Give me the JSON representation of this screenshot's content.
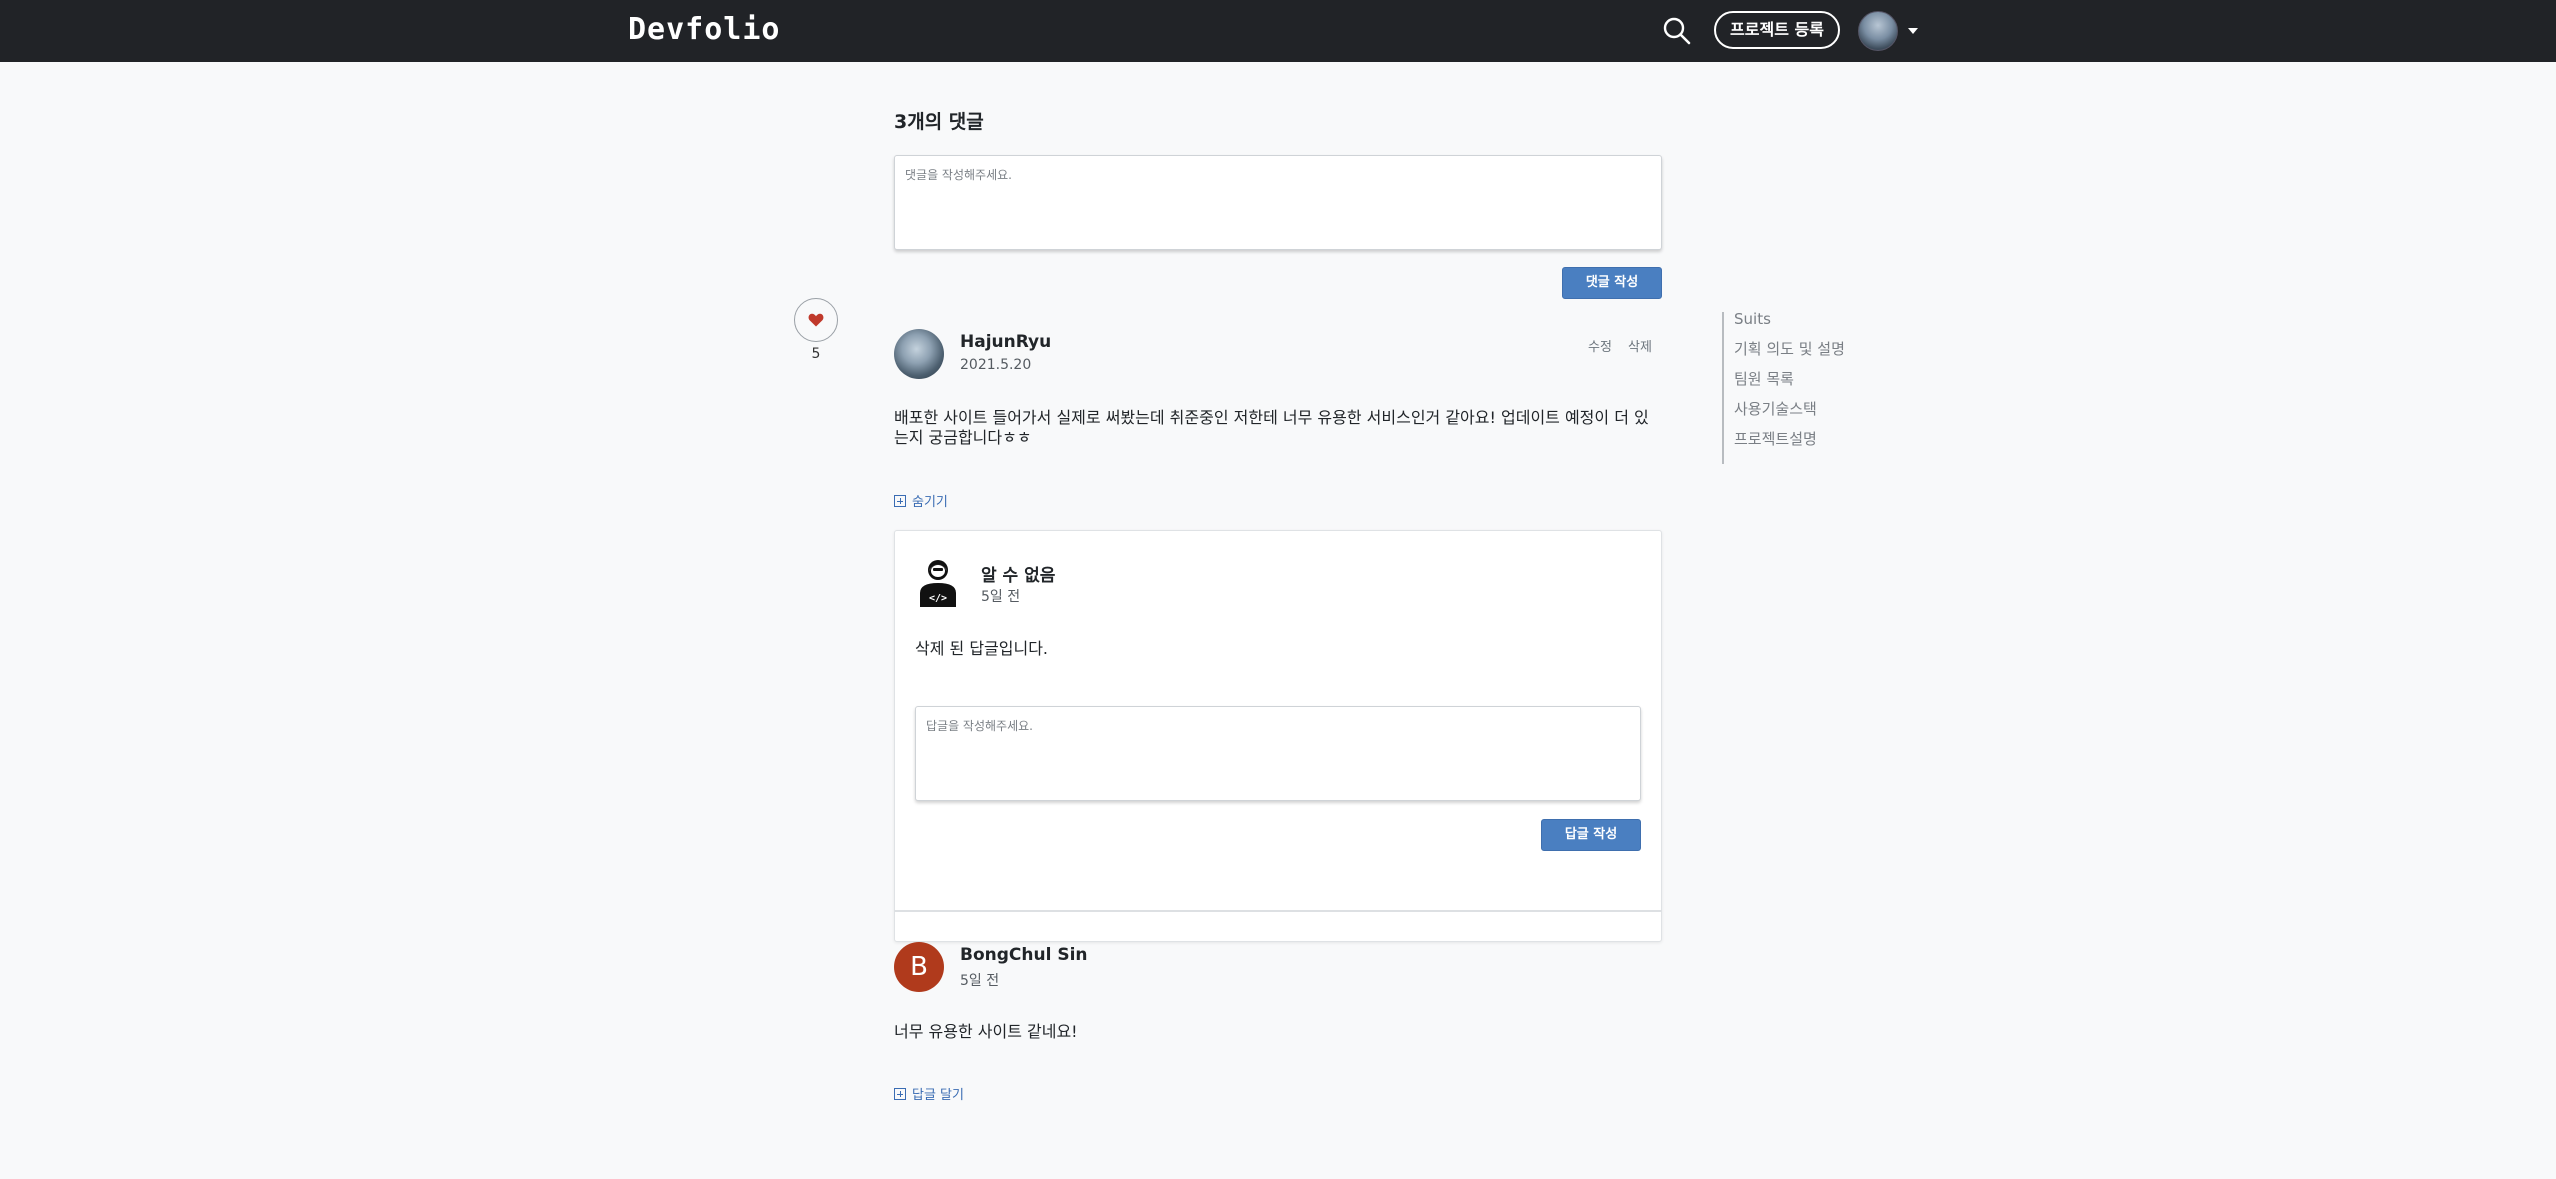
{
  "nav": {
    "logo": "Devfolio",
    "register_label": "프로젝트 등록"
  },
  "comments": {
    "count_label": "3개의 댓글",
    "input_placeholder": "댓글을 작성해주세요.",
    "submit_label": "댓글 작성",
    "like_count": "5",
    "items": [
      {
        "author": "HajunRyu",
        "date": "2021.5.20",
        "edit_label": "수정",
        "delete_label": "삭제",
        "body": "배포한 사이트 들어가서 실제로 써봤는데 취준중인 저한테 너무 유용한 서비스인거 같아요! 업데이트 예정이 더 있는지 궁금합니다ㅎㅎ",
        "toggle_label": "숨기기",
        "reply": {
          "author": "알 수 없음",
          "date": "5일 전",
          "body": "삭제 된 답글입니다.",
          "input_placeholder": "답글을 작성해주세요.",
          "submit_label": "답글 작성"
        }
      },
      {
        "avatar_letter": "B",
        "author": "BongChul Sin",
        "date": "5일 전",
        "body": "너무 유용한 사이트 같네요!",
        "toggle_label": "답글 달기"
      }
    ]
  },
  "toc": {
    "items": [
      "Suits",
      "기획 의도 및 설명",
      "팀원 목록",
      "사용기술스택",
      "프로젝트설명"
    ]
  },
  "colors": {
    "nav_bg": "#212327",
    "primary": "#4a7fc1",
    "avatar_letter_bg": "#b03a1c",
    "heart": "#c0392b"
  }
}
